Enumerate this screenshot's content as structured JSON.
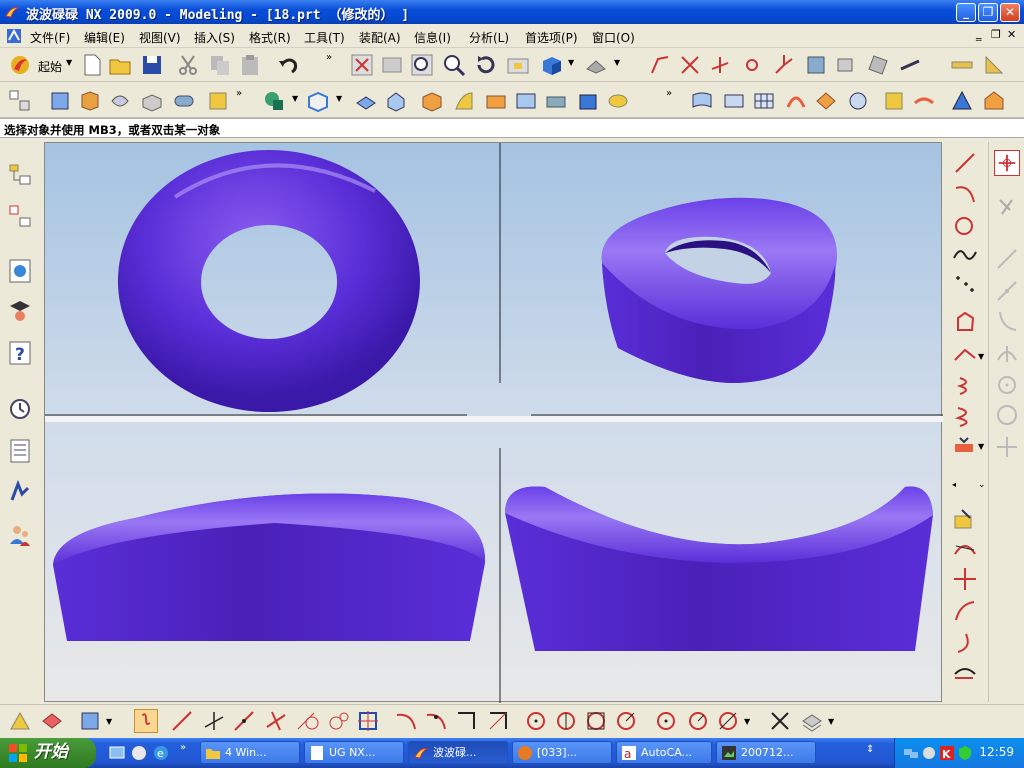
{
  "window": {
    "title": "波波碌碌 NX 2009.0 - Modeling - [18.prt （修改的） ]",
    "min_label": "_",
    "max_label": "❐",
    "close_label": "✕"
  },
  "menubar": {
    "items": [
      "文件(F)",
      "编辑(E)",
      "视图(V)",
      "插入(S)",
      "格式(R)",
      "工具(T)",
      "装配(A)",
      "信息(I)",
      "分析(L)",
      "首选项(P)",
      "窗口(O)"
    ]
  },
  "toolbar": {
    "start_label": "起始"
  },
  "prompt": {
    "text": "选择对象并使用 MB3，或者双击某一对象"
  },
  "taskbar": {
    "start_label": "开始",
    "tasks": [
      "4 Win...",
      "UG NX...",
      "波波碌...",
      "[033]...",
      "AutoCA...",
      "200712..."
    ],
    "clock": "12:59"
  },
  "colors": {
    "model_purple": "#5a2ed8",
    "titlebar_blue": "#0a4ed8",
    "taskbar_blue": "#245edb",
    "start_green": "#3c8a2e"
  }
}
